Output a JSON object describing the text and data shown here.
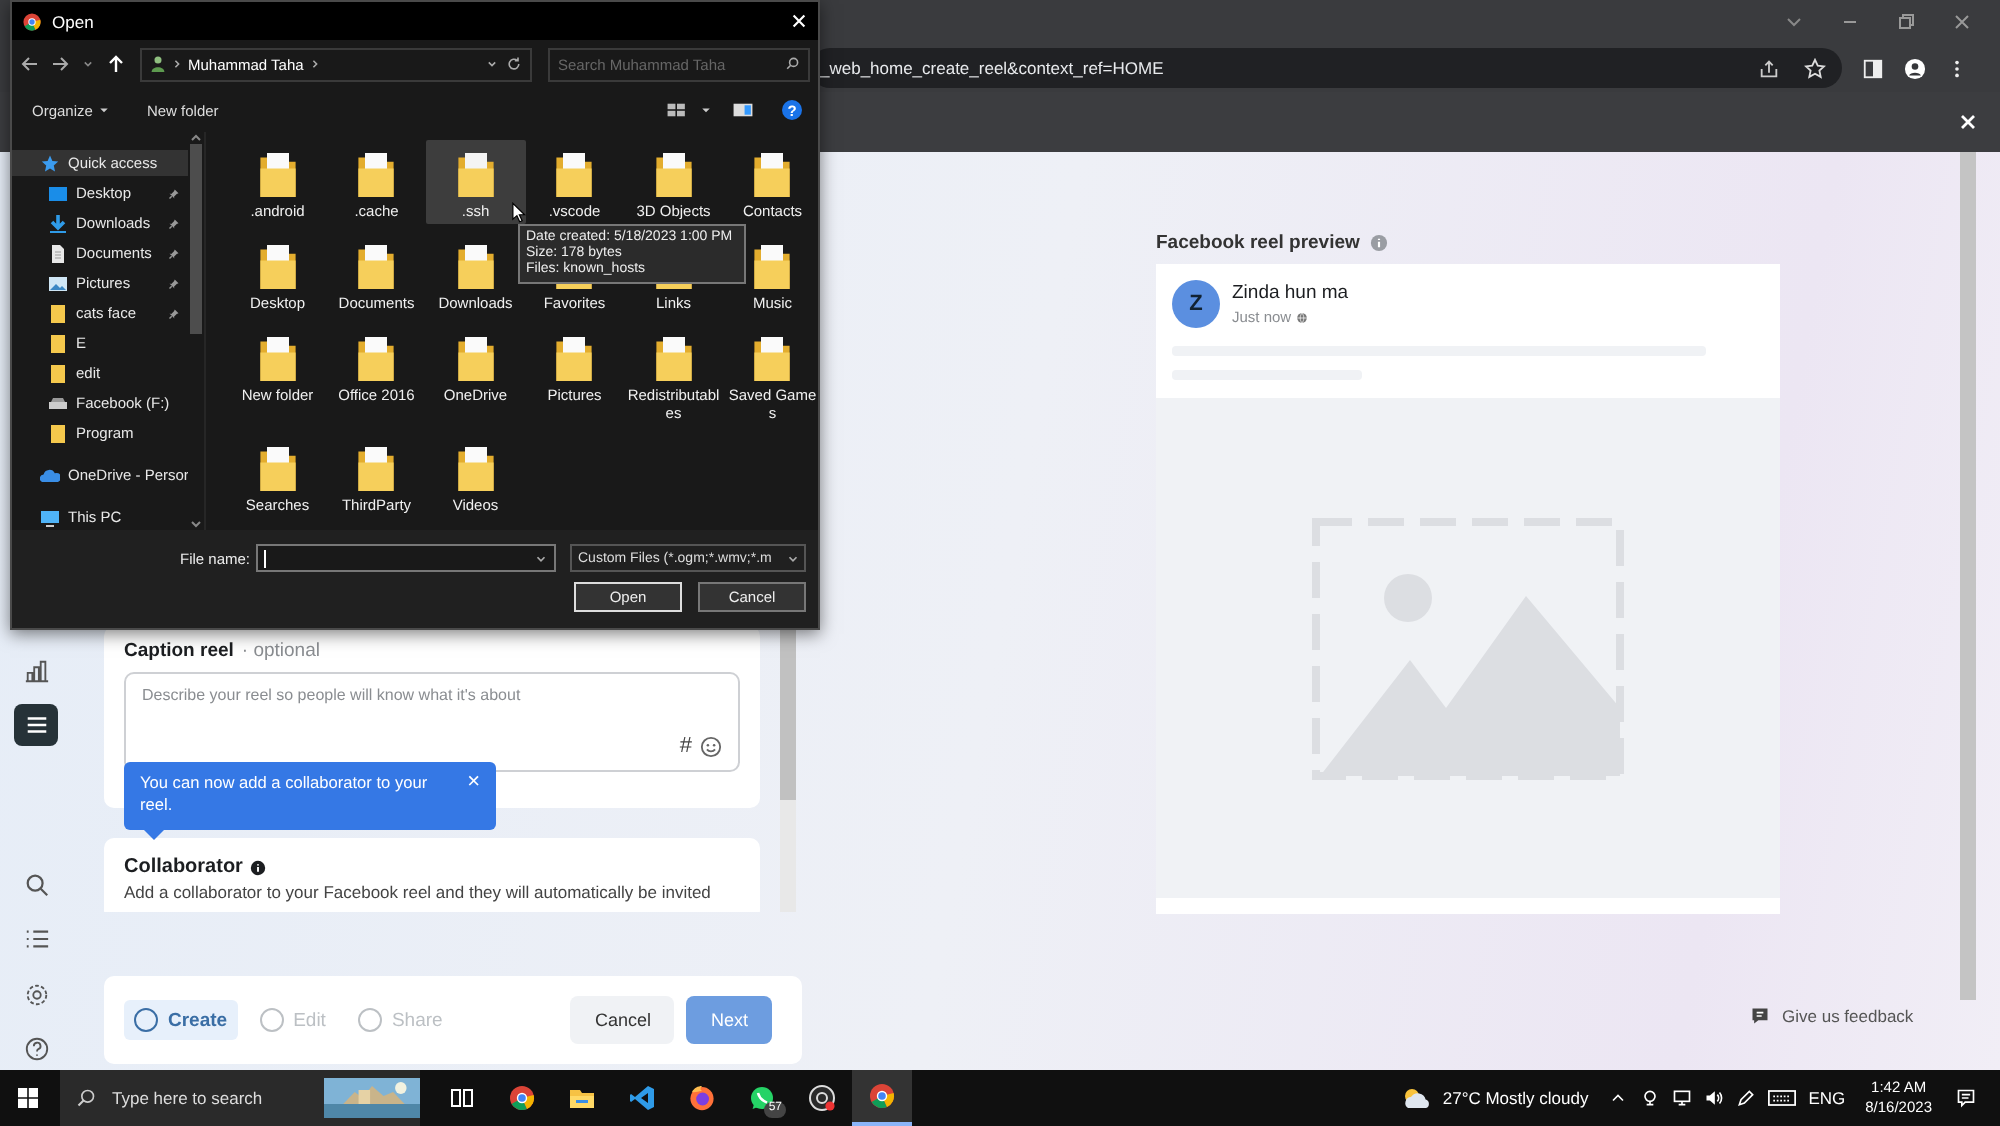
{
  "browser": {
    "url": "_web_home_create_reel&context_ref=HOME"
  },
  "left_rail": [
    {
      "kind": "insights",
      "selected": false
    },
    {
      "kind": "menu",
      "selected": true
    },
    {
      "kind": "search",
      "selected": false
    },
    {
      "kind": "list",
      "selected": false
    },
    {
      "kind": "settings",
      "selected": false
    },
    {
      "kind": "help",
      "selected": false
    }
  ],
  "caption": {
    "title": "Caption reel",
    "optional": "· optional",
    "placeholder": "Describe your reel so people will know what it's about",
    "hashtag": "#"
  },
  "tip": {
    "text": "You can now add a collaborator to your reel.",
    "close": "×"
  },
  "collaborator": {
    "title": "Collaborator",
    "description": "Add a collaborator to your Facebook reel and they will automatically be invited"
  },
  "steps": [
    {
      "label": "Create",
      "selected": true
    },
    {
      "label": "Edit",
      "selected": false
    },
    {
      "label": "Share",
      "selected": false
    }
  ],
  "buttons": [
    {
      "label": "Cancel",
      "kind": "secondary",
      "disabled": false
    },
    {
      "label": "Next",
      "kind": "primary",
      "disabled": true
    }
  ],
  "preview": {
    "title": "Facebook reel preview",
    "avatar": "Z",
    "name": "Zinda hun ma",
    "time": "Just now"
  },
  "feedback": "Give us feedback",
  "dialog": {
    "title": "Open",
    "path": "Muhammad Taha",
    "search_placeholder": "Search Muhammad Taha",
    "organize": "Organize",
    "new_folder": "New folder",
    "help": "?",
    "sidebar": [
      {
        "label": "Quick access",
        "kind": "star",
        "selected": true,
        "children": [
          {
            "label": "Desktop",
            "kind": "desktop",
            "pinned": true
          },
          {
            "label": "Downloads",
            "kind": "downloads",
            "pinned": true
          },
          {
            "label": "Documents",
            "kind": "documents",
            "pinned": true
          },
          {
            "label": "Pictures",
            "kind": "pictures",
            "pinned": true
          },
          {
            "label": "cats face",
            "kind": "folder",
            "pinned": true
          },
          {
            "label": "E",
            "kind": "folder",
            "pinned": false
          },
          {
            "label": "edit",
            "kind": "folder",
            "pinned": false
          },
          {
            "label": "Facebook (F:)",
            "kind": "drive",
            "pinned": false
          },
          {
            "label": "Program",
            "kind": "folder",
            "pinned": false
          }
        ]
      },
      {
        "label": "OneDrive - Persor",
        "kind": "onedrive",
        "selected": false
      },
      {
        "label": "This PC",
        "kind": "pc",
        "selected": false
      }
    ],
    "files": [
      {
        "name": ".android",
        "selected": false
      },
      {
        "name": ".cache",
        "selected": false
      },
      {
        "name": ".ssh",
        "selected": true
      },
      {
        "name": ".vscode",
        "selected": false
      },
      {
        "name": "3D Objects",
        "selected": false
      },
      {
        "name": "Contacts",
        "selected": false
      },
      {
        "name": "Desktop",
        "selected": false
      },
      {
        "name": "Documents",
        "selected": false
      },
      {
        "name": "Downloads",
        "selected": false
      },
      {
        "name": "Favorites",
        "selected": false
      },
      {
        "name": "Links",
        "selected": false
      },
      {
        "name": "Music",
        "selected": false
      },
      {
        "name": "New folder",
        "selected": false
      },
      {
        "name": "Office 2016",
        "selected": false
      },
      {
        "name": "OneDrive",
        "selected": false
      },
      {
        "name": "Pictures",
        "selected": false
      },
      {
        "name": "Redistributables",
        "selected": false
      },
      {
        "name": "Saved Games",
        "selected": false
      },
      {
        "name": "Searches",
        "selected": false
      },
      {
        "name": "ThirdParty",
        "selected": false
      },
      {
        "name": "Videos",
        "selected": false
      }
    ],
    "tooltip": [
      "Date created: 5/18/2023 1:00 PM",
      "Size: 178 bytes",
      "Files: known_hosts"
    ],
    "file_name_label": "File name:",
    "file_type": "Custom Files (*.ogm;*.wmv;*.m",
    "open": "Open",
    "cancel": "Cancel"
  },
  "taskbar": {
    "search_placeholder": "Type here to search",
    "apps": [
      {
        "kind": "taskview",
        "selected": false
      },
      {
        "kind": "chrome",
        "selected": false
      },
      {
        "kind": "explorer",
        "selected": false
      },
      {
        "kind": "vscode",
        "selected": false
      },
      {
        "kind": "firefox",
        "selected": false
      },
      {
        "kind": "whatsapp",
        "selected": false,
        "badge": "57"
      },
      {
        "kind": "recorder",
        "selected": false
      },
      {
        "kind": "chrome",
        "selected": true
      }
    ],
    "weather": "27°C Mostly cloudy",
    "language": "ENG",
    "time": "1:42 AM",
    "date": "8/16/2023"
  }
}
